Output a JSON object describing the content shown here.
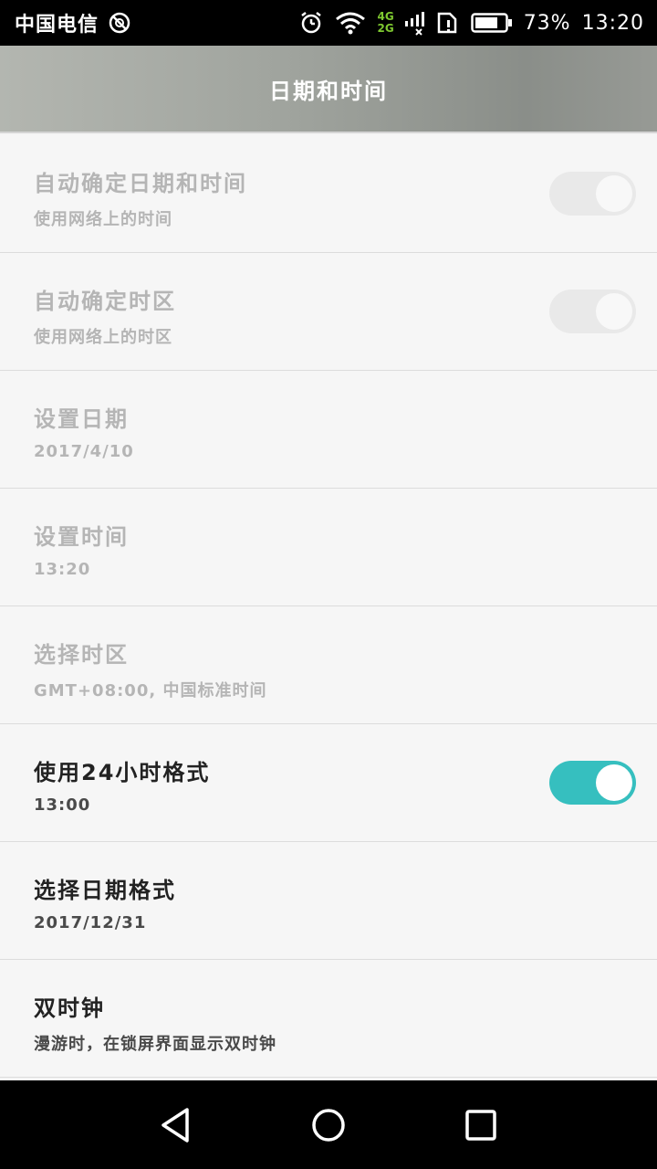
{
  "status_bar": {
    "carrier": "中国电信",
    "network_top": "4G",
    "network_bottom": "2G",
    "battery_percent": "73%",
    "time": "13:20",
    "icons": [
      "no-disturb-icon",
      "alarm-icon",
      "wifi-icon",
      "signal-icon",
      "sim-alert-icon",
      "battery-icon"
    ],
    "battery_level": 0.73
  },
  "header": {
    "title": "日期和时间"
  },
  "settings": {
    "items": [
      {
        "title": "自动确定日期和时间",
        "subtitle": "使用网络上的时间",
        "enabled": false,
        "toggle": "off"
      },
      {
        "title": "自动确定时区",
        "subtitle": "使用网络上的时区",
        "enabled": false,
        "toggle": "off"
      },
      {
        "title": "设置日期",
        "subtitle": "2017/4/10",
        "enabled": false
      },
      {
        "title": "设置时间",
        "subtitle": "13:20",
        "enabled": false
      },
      {
        "title": "选择时区",
        "subtitle": "GMT+08:00, 中国标准时间",
        "enabled": false
      },
      {
        "title": "使用24小时格式",
        "subtitle": "13:00",
        "enabled": true,
        "toggle": "on"
      },
      {
        "title": "选择日期格式",
        "subtitle": "2017/12/31",
        "enabled": true
      },
      {
        "title": "双时钟",
        "subtitle": "漫游时，在锁屏界面显示双时钟",
        "enabled": true
      }
    ]
  },
  "nav_bar": {
    "icons": [
      "back-icon",
      "home-icon",
      "recents-icon"
    ]
  },
  "colors": {
    "accent": "#36bfbf",
    "title_bar": "#9a9e99",
    "disabled_text": "#b5b5b5"
  }
}
